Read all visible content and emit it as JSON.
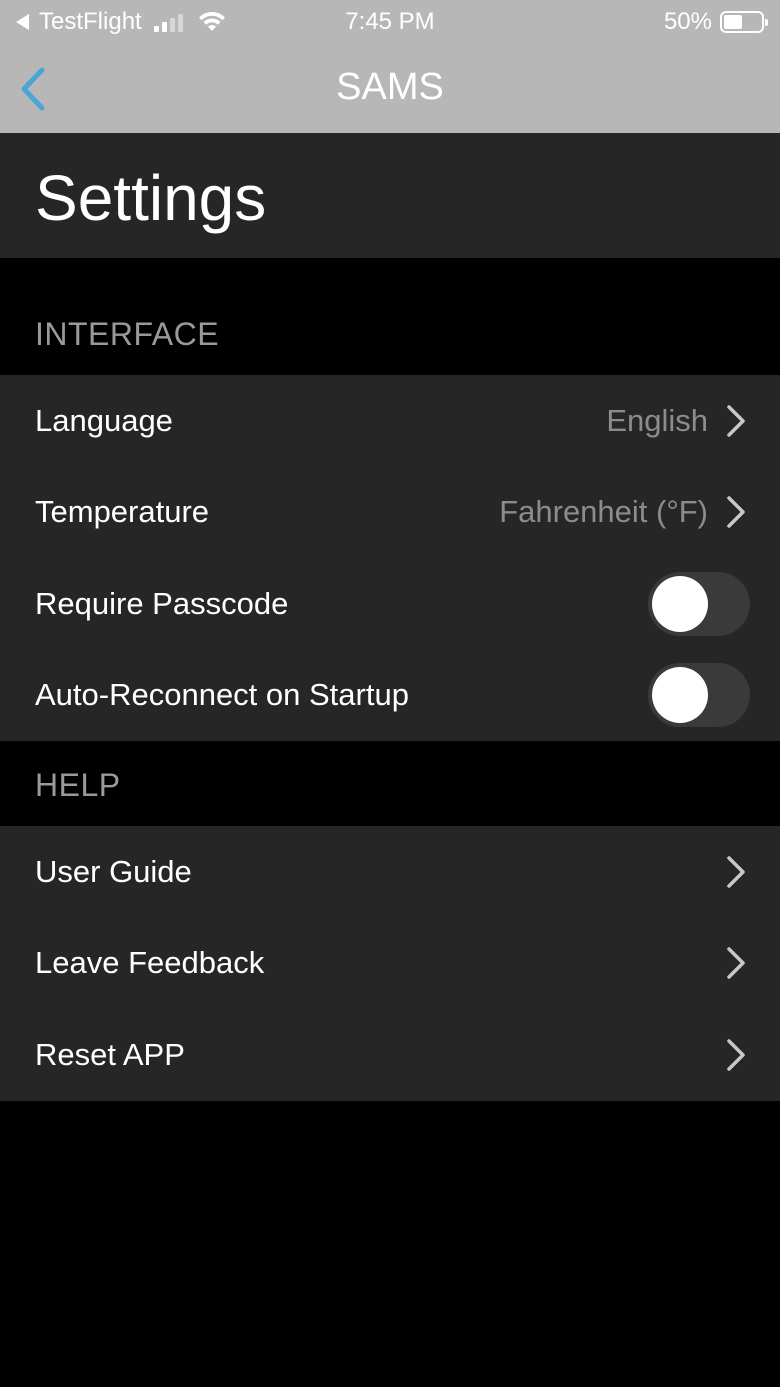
{
  "status_bar": {
    "back_app": "TestFlight",
    "time": "7:45 PM",
    "battery_percent": "50%",
    "battery_level": 0.5,
    "signal_bars": 2,
    "icons": [
      "back-triangle-icon",
      "signal-icon",
      "wifi-icon",
      "battery-icon"
    ]
  },
  "nav": {
    "title": "SAMS",
    "back_icon": "chevron-left-icon",
    "back_color": "#4aa6d8"
  },
  "page_title": "Settings",
  "sections": {
    "interface": {
      "header": "INTERFACE",
      "rows": {
        "language": {
          "label": "Language",
          "value": "English"
        },
        "temperature": {
          "label": "Temperature",
          "value": "Fahrenheit (°F)"
        },
        "require_passcode": {
          "label": "Require Passcode",
          "on": false
        },
        "auto_reconnect": {
          "label": "Auto-Reconnect on Startup",
          "on": false
        }
      }
    },
    "help": {
      "header": "HELP",
      "rows": {
        "user_guide": {
          "label": "User Guide"
        },
        "leave_feedback": {
          "label": "Leave Feedback"
        },
        "reset_app": {
          "label": "Reset APP"
        }
      }
    }
  }
}
